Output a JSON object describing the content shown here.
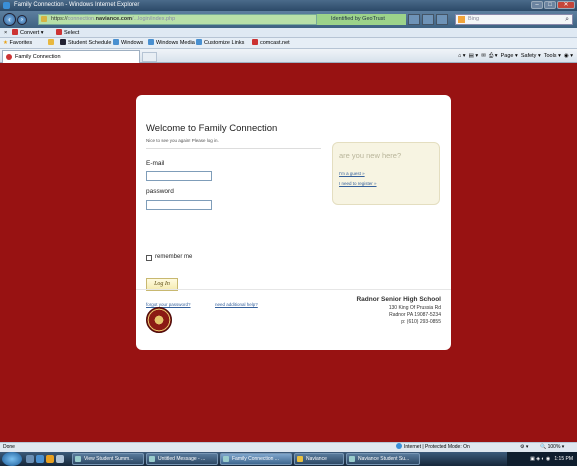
{
  "window": {
    "title": "Family Connection - Windows Internet Explorer",
    "buttons": {
      "minimize": "–",
      "maximize": "□",
      "close": "✕"
    }
  },
  "address_bar": {
    "url_scheme": "https://",
    "url_host_blurred": "connection.",
    "url_host": "naviance.com",
    "url_path_blurred": "/...login/index.php",
    "identity": "Identified by GeoTrust",
    "search_placeholder": "Bing"
  },
  "toolbar1": {
    "close": "×",
    "convert": "Convert",
    "select": "Select"
  },
  "favorites_bar": {
    "favorites": "Favorites",
    "items": [
      "Student Schedule",
      "Windows",
      "Windows Media",
      "Customize Links",
      "comcast.net"
    ]
  },
  "tabs": {
    "active": "Family Connection",
    "tools": [
      "Page ▾",
      "Safety ▾",
      "Tools ▾"
    ]
  },
  "login": {
    "heading": "Welcome to Family Connection",
    "subheading": "Nice to see you again! Please log in.",
    "email_label": "E-mail",
    "password_label": "password",
    "remember_label": "remember me",
    "login_button": "Log In",
    "forgot_link": "forgot your password?",
    "help_link": "need additional help?"
  },
  "new_here": {
    "heading": "are you new here?",
    "guest_link": "I'm a guest »",
    "register_link": "I need to register »"
  },
  "school": {
    "name": "Radnor Senior High School",
    "address1": "130 King Of Prussia Rd",
    "address2": "Radnor PA 19087-5234",
    "phone": "p: (610) 293-0855"
  },
  "status_bar": {
    "left": "Done",
    "zone": "Internet | Protected Mode: On",
    "zoom": "100%"
  },
  "taskbar": {
    "tasks": [
      "View Student Summ...",
      "Untitled Message - ...",
      "Family Connection ...",
      "Naviance",
      "Naviance Student Su..."
    ],
    "active_index": 2,
    "clock": "1:15 PM"
  }
}
